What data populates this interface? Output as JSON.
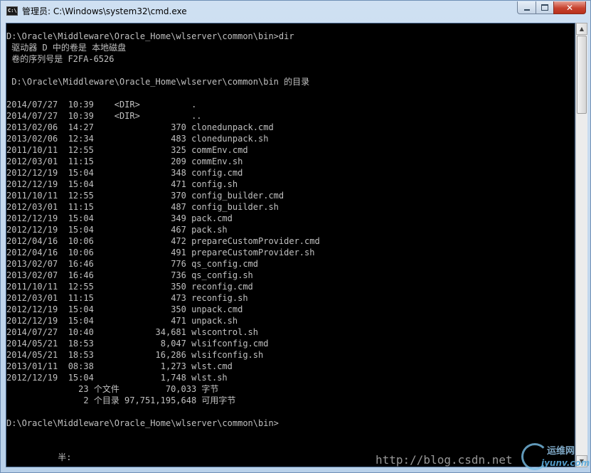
{
  "window": {
    "title": "管理员: C:\\Windows\\system32\\cmd.exe",
    "icon": "cmd-icon",
    "controls": {
      "minimize": "minimize-icon",
      "maximize": "maximize-icon",
      "close": "✕"
    }
  },
  "console": {
    "lines": [
      {
        "text": "D:\\Oracle\\Middleware\\Oracle_Home\\wlserver\\common\\bin>dir",
        "row": 0
      },
      {
        "text": " 驱动器 D 中的卷是 本地磁盘",
        "row": 1
      },
      {
        "text": " 卷的序列号是 F2FA-6526",
        "row": 2
      },
      {
        "text": " D:\\Oracle\\Middleware\\Oracle_Home\\wlserver\\common\\bin 的目录",
        "row": 4
      },
      {
        "text": "2014/07/27  10:39    <DIR>          .",
        "row": 6
      },
      {
        "text": "2014/07/27  10:39    <DIR>          ..",
        "row": 7
      },
      {
        "text": "2013/02/06  14:27               370 clonedunpack.cmd",
        "row": 8
      },
      {
        "text": "2013/02/06  12:34               483 clonedunpack.sh",
        "row": 9
      },
      {
        "text": "2011/10/11  12:55               325 commEnv.cmd",
        "row": 10
      },
      {
        "text": "2012/03/01  11:15               209 commEnv.sh",
        "row": 11
      },
      {
        "text": "2012/12/19  15:04               348 config.cmd",
        "row": 12
      },
      {
        "text": "2012/12/19  15:04               471 config.sh",
        "row": 13
      },
      {
        "text": "2011/10/11  12:55               370 config_builder.cmd",
        "row": 14
      },
      {
        "text": "2012/03/01  11:15               487 config_builder.sh",
        "row": 15
      },
      {
        "text": "2012/12/19  15:04               349 pack.cmd",
        "row": 16
      },
      {
        "text": "2012/12/19  15:04               467 pack.sh",
        "row": 17
      },
      {
        "text": "2012/04/16  10:06               472 prepareCustomProvider.cmd",
        "row": 18
      },
      {
        "text": "2012/04/16  10:06               491 prepareCustomProvider.sh",
        "row": 19
      },
      {
        "text": "2013/02/07  16:46               776 qs_config.cmd",
        "row": 20
      },
      {
        "text": "2013/02/07  16:46               736 qs_config.sh",
        "row": 21
      },
      {
        "text": "2011/10/11  12:55               350 reconfig.cmd",
        "row": 22
      },
      {
        "text": "2012/03/01  11:15               473 reconfig.sh",
        "row": 23
      },
      {
        "text": "2012/12/19  15:04               350 unpack.cmd",
        "row": 24
      },
      {
        "text": "2012/12/19  15:04               471 unpack.sh",
        "row": 25
      },
      {
        "text": "2014/07/27  10:40            34,681 wlscontrol.sh",
        "row": 26
      },
      {
        "text": "2014/05/21  18:53             8,047 wlsifconfig.cmd",
        "row": 27
      },
      {
        "text": "2014/05/21  18:53            16,286 wlsifconfig.sh",
        "row": 28
      },
      {
        "text": "2013/01/11  08:38             1,273 wlst.cmd",
        "row": 29
      },
      {
        "text": "2012/12/19  15:04             1,748 wlst.sh",
        "row": 30
      },
      {
        "text": "              23 个文件         70,033 字节",
        "row": 31
      },
      {
        "text": "               2 个目录 97,751,195,648 可用字节",
        "row": 32
      },
      {
        "text": "D:\\Oracle\\Middleware\\Oracle_Home\\wlserver\\common\\bin>",
        "row": 34
      },
      {
        "text": "          半:",
        "row": 37
      }
    ]
  },
  "watermark": {
    "url": "http://blog.csdn.net",
    "brand_top": "运维网",
    "brand_bottom": "iyunv.com"
  },
  "colors": {
    "console_bg": "#000000",
    "console_fg": "#c0c0c0",
    "titlebar_bg": "#c4d8ee",
    "close_red": "#c7432f"
  }
}
